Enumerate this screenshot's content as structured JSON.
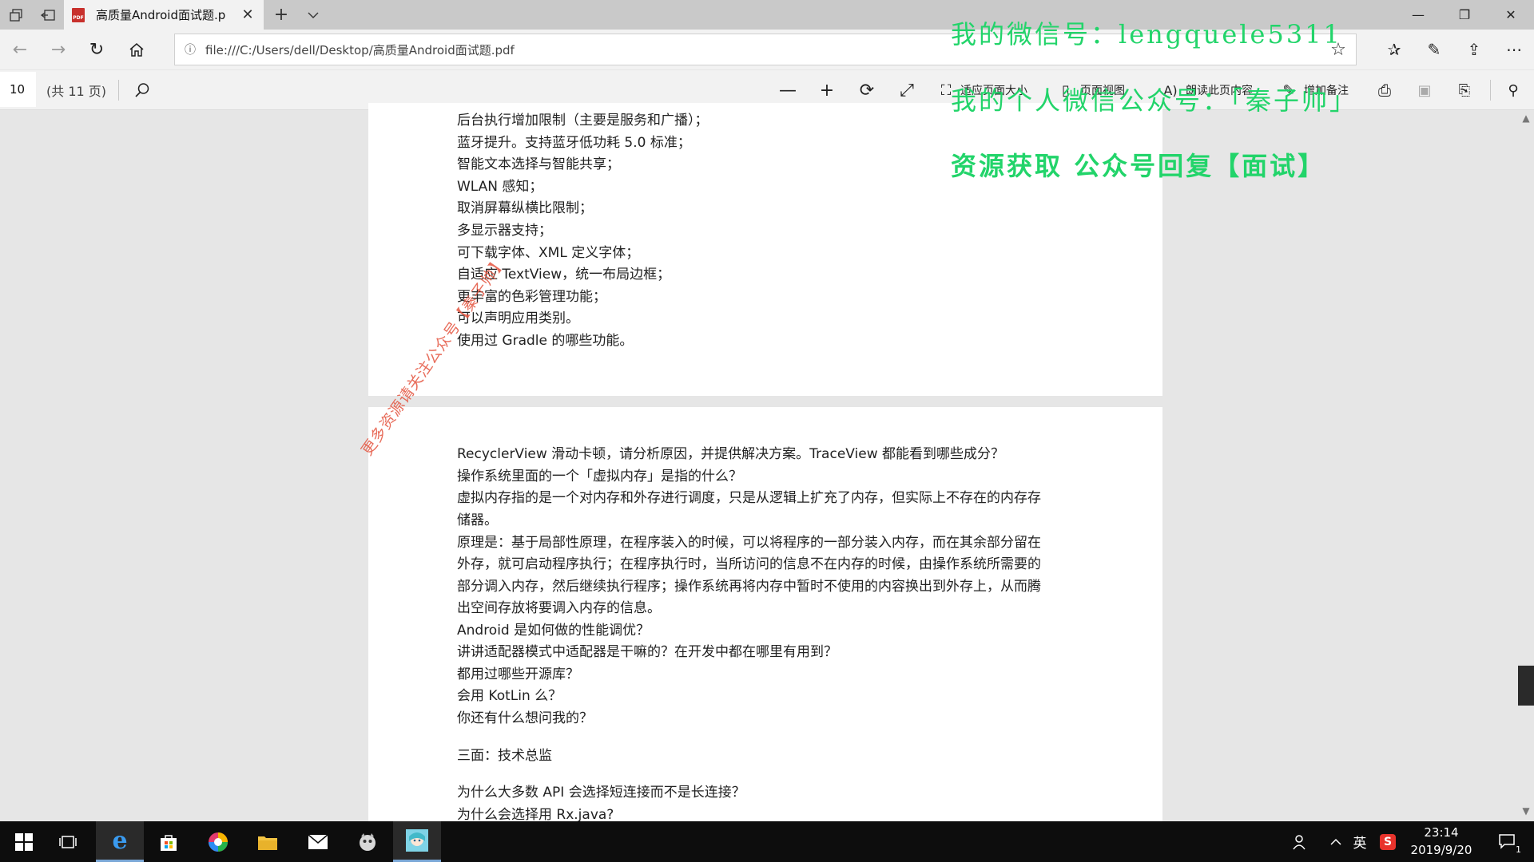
{
  "browser": {
    "tab_title": "高质量Android面试题.p",
    "tab_close": "✕",
    "new_tab": "+",
    "url": "file:///C:/Users/dell/Desktop/高质量Android面试题.pdf",
    "window_controls": {
      "minimize": "—",
      "maximize": "❐",
      "close": "✕"
    }
  },
  "pdf_toolbar": {
    "page_number": "10",
    "page_count": "(共 11 页)",
    "fit_page_label": "适应页面大小",
    "page_view_label": "页面视图",
    "read_aloud_label": "朗读此页内容",
    "add_notes_label": "增加备注"
  },
  "document": {
    "page1_lines": [
      "后台执行增加限制（主要是服务和广播）；",
      "蓝牙提升。支持蓝牙低功耗 5.0 标准；",
      "智能文本选择与智能共享；",
      "WLAN 感知；",
      "取消屏幕纵横比限制；",
      "多显示器支持；",
      "可下载字体、XML 定义字体；",
      "自适应 TextView，统一布局边框；",
      "更丰富的色彩管理功能；",
      "可以声明应用类别。",
      "使用过 Gradle 的哪些功能。"
    ],
    "page2_lines": [
      "RecyclerView 滑动卡顿，请分析原因，并提供解决方案。TraceView 都能看到哪些成分？",
      "操作系统里面的一个「虚拟内存」是指的什么？",
      "虚拟内存指的是一个对内存和外存进行调度，只是从逻辑上扩充了内存，但实际上不存在的内存存",
      "储器。",
      "原理是：基于局部性原理，在程序装入的时候，可以将程序的一部分装入内存，而在其余部分留在",
      "外存，就可启动程序执行；在程序执行时，当所访问的信息不在内存的时候，由操作系统所需要的",
      "部分调入内存，然后继续执行程序；操作系统再将内存中暂时不使用的内容换出到外存上，从而腾",
      "出空间存放将要调入内存的信息。",
      "Android 是如何做的性能调优？",
      "讲讲适配器模式中适配器是干嘛的？在开发中都在哪里有用到？",
      "都用过哪些开源库？",
      "会用 KotLin 么？",
      "你还有什么想问我的？",
      "三面：技术总监",
      "为什么大多数 API 会选择短连接而不是长连接？",
      "为什么会选择用 Rx.java?"
    ],
    "stamp_text": "更多资源请关注公众号【秦子帅】"
  },
  "watermarks": {
    "wechat_id": "我的微信号：lengquele5311",
    "official_account": "我的个人微信公众号：「秦子帅」",
    "resource_hint": "资源获取 公众号回复【面试】"
  },
  "taskbar": {
    "ime_label": "英",
    "time": "23:14",
    "date": "2019/9/20",
    "notification_count": "1"
  },
  "colors": {
    "watermark_green": "#22d46a",
    "stamp_red": "#e4543f",
    "pdf_icon_red": "#c8302c"
  }
}
